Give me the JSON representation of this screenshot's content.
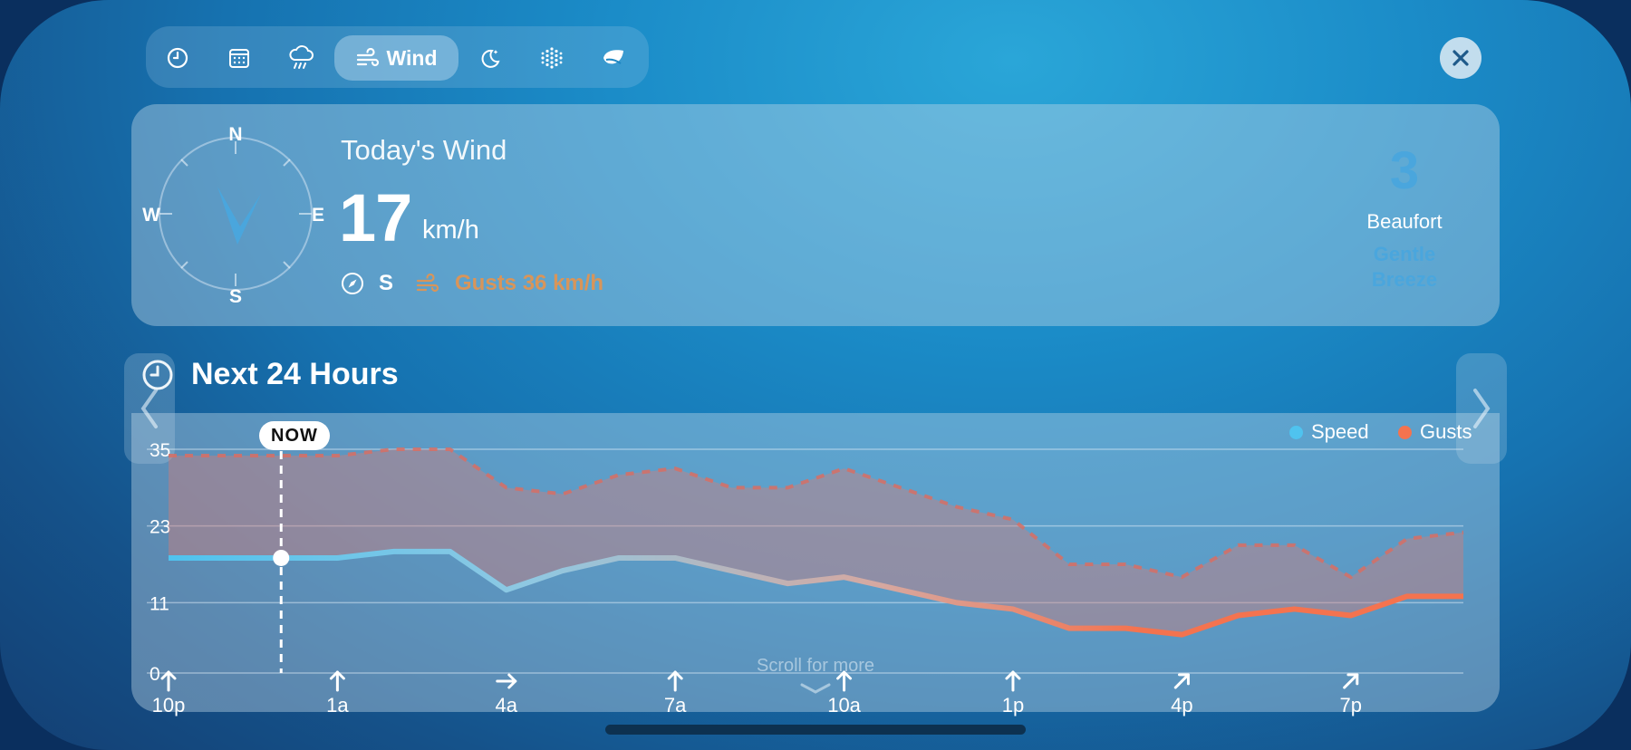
{
  "tabs": [
    {
      "icon": "clock-icon"
    },
    {
      "icon": "calendar-icon"
    },
    {
      "icon": "rain-cloud-icon"
    },
    {
      "icon": "wind-icon",
      "label": "Wind",
      "active": true
    },
    {
      "icon": "moon-icon"
    },
    {
      "icon": "snow-icon"
    },
    {
      "icon": "leaf-icon"
    }
  ],
  "summary": {
    "title": "Today's Wind",
    "speed": "17",
    "unit": "km/h",
    "direction": "S",
    "gusts": "Gusts 36 km/h",
    "compass": {
      "n": "N",
      "e": "E",
      "s": "S",
      "w": "W"
    },
    "beaufort_number": "3",
    "beaufort_label": "Beaufort",
    "beaufort_desc_1": "Gentle",
    "beaufort_desc_2": "Breeze"
  },
  "forecast": {
    "title": "Next 24 Hours",
    "now_label": "NOW",
    "scroll_hint": "Scroll for more"
  },
  "colors": {
    "speed": "#4fc3ef",
    "gusts": "#f4734f",
    "beaufort": "#4aa6dd"
  },
  "chart_data": {
    "type": "line",
    "ylim": [
      0,
      35
    ],
    "yticks": [
      0,
      11,
      23,
      35
    ],
    "x_tick_labels": [
      "10p",
      "1a",
      "4a",
      "7a",
      "10a",
      "1p",
      "4p",
      "7p"
    ],
    "x_tick_directions": [
      "N",
      "N",
      "E",
      "N",
      "N",
      "N",
      "NE",
      "NE"
    ],
    "now_index": 2,
    "series": [
      {
        "name": "Speed",
        "values": [
          18,
          18,
          18,
          18,
          19,
          19,
          13,
          16,
          18,
          18,
          16,
          14,
          15,
          13,
          11,
          10,
          7,
          7,
          6,
          9,
          10,
          9,
          12,
          12
        ]
      },
      {
        "name": "Gusts",
        "values": [
          34,
          34,
          34,
          34,
          35,
          35,
          29,
          28,
          31,
          32,
          29,
          29,
          32,
          29,
          26,
          24,
          17,
          17,
          15,
          20,
          20,
          15,
          21,
          22
        ]
      }
    ]
  }
}
